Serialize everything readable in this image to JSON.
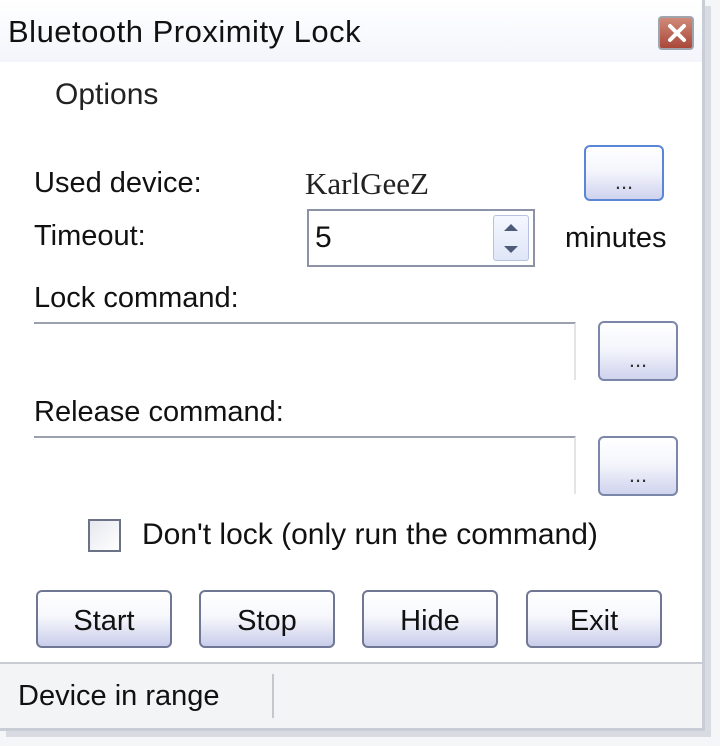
{
  "window": {
    "title": "Bluetooth Proximity Lock",
    "close_icon": "close-icon"
  },
  "menu": {
    "options_label": "Options"
  },
  "device": {
    "label": "Used device:",
    "name": "KarlGeeZ",
    "browse_label": "..."
  },
  "timeout": {
    "label": "Timeout:",
    "value": "5",
    "unit": "minutes"
  },
  "lock_command": {
    "label": "Lock command:",
    "value": "",
    "browse_label": "..."
  },
  "release_command": {
    "label": "Release command:",
    "value": "",
    "browse_label": "..."
  },
  "dont_lock": {
    "label": "Don't lock (only run the command)",
    "checked": false
  },
  "buttons": {
    "start": "Start",
    "stop": "Stop",
    "hide": "Hide",
    "exit": "Exit"
  },
  "status": {
    "text": "Device in range"
  },
  "colors": {
    "close_button": "#b85a48",
    "button_gradient_bottom": "#c9cdea",
    "focus_border": "#5b86d6"
  }
}
